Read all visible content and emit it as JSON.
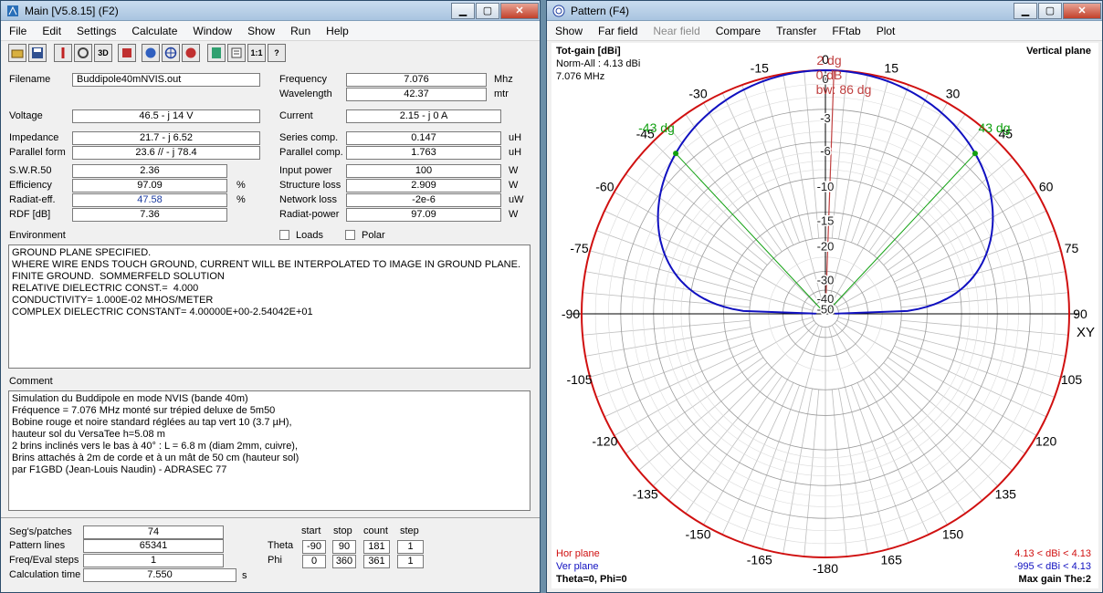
{
  "main": {
    "title": "Main [V5.8.15]   (F2)",
    "menu": [
      "File",
      "Edit",
      "Settings",
      "Calculate",
      "Window",
      "Show",
      "Run",
      "Help"
    ],
    "toolbar_icons": [
      "open-icon",
      "save-icon",
      "edit-icon",
      "3d-icon",
      "view-icon",
      "globe-icon",
      "pattern-icon",
      "sweep-icon",
      "calc-icon",
      "list-icon",
      "ratio-icon",
      "help-icon"
    ],
    "toolbar_text": {
      "3d": "3D",
      "ratio": "1:1",
      "help": "?"
    },
    "filename_label": "Filename",
    "filename": "Buddipole40mNVIS.out",
    "frequency_label": "Frequency",
    "frequency": "7.076",
    "frequency_unit": "Mhz",
    "wavelength_label": "Wavelength",
    "wavelength": "42.37",
    "wavelength_unit": "mtr",
    "voltage_label": "Voltage",
    "voltage": "46.5 - j 14 V",
    "current_label": "Current",
    "current": "2.15 - j 0 A",
    "impedance_label": "Impedance",
    "impedance": "21.7 - j 6.52",
    "parallel_label": "Parallel form",
    "parallel": "23.6 // - j 78.4",
    "series_comp_label": "Series comp.",
    "series_comp": "0.147",
    "series_comp_unit": "uH",
    "parallel_comp_label": "Parallel comp.",
    "parallel_comp": "1.763",
    "parallel_comp_unit": "uH",
    "swr_label": "S.W.R.50",
    "swr": "2.36",
    "efficiency_label": "Efficiency",
    "efficiency": "97.09",
    "pct": "%",
    "radiat_eff_label": "Radiat-eff.",
    "radiat_eff": "47.58",
    "rdf_label": "RDF [dB]",
    "rdf": "7.36",
    "input_power_label": "Input power",
    "input_power": "100",
    "structure_loss_label": "Structure loss",
    "structure_loss": "2.909",
    "network_loss_label": "Network loss",
    "network_loss": "-2e-6",
    "radiat_power_label": "Radiat-power",
    "radiat_power": "97.09",
    "w_unit": "W",
    "uw_unit": "uW",
    "environment_label": "Environment",
    "loads_label": "Loads",
    "polar_label": "Polar",
    "environment_text": "GROUND PLANE SPECIFIED.\nWHERE WIRE ENDS TOUCH GROUND, CURRENT WILL BE INTERPOLATED TO IMAGE IN GROUND PLANE.\nFINITE GROUND.  SOMMERFELD SOLUTION\nRELATIVE DIELECTRIC CONST.=  4.000\nCONDUCTIVITY= 1.000E-02 MHOS/METER\nCOMPLEX DIELECTRIC CONSTANT= 4.00000E+00-2.54042E+01",
    "comment_label": "Comment",
    "comment_text": "Simulation du Buddipole en mode NVIS (bande 40m)\nFréquence = 7.076 MHz monté sur trépied deluxe de 5m50\nBobine rouge et noire standard réglées au tap vert 10 (3.7 µH),\nhauteur sol du VersaTee h=5.08 m\n2 brins inclinés vers le bas à 40° : L = 6.8 m (diam 2mm, cuivre),\nBrins attachés à 2m de corde et à un mât de 50 cm (hauteur sol)\npar F1GBD (Jean-Louis Naudin) - ADRASEC 77",
    "segs_label": "Seg's/patches",
    "segs": "74",
    "pattern_lines_label": "Pattern lines",
    "pattern_lines": "65341",
    "freq_eval_label": "Freq/Eval steps",
    "freq_eval": "1",
    "calc_time_label": "Calculation time",
    "calc_time": "7.550",
    "calc_time_unit": "s",
    "col_start": "start",
    "col_stop": "stop",
    "col_count": "count",
    "col_step": "step",
    "theta_label": "Theta",
    "theta": [
      "-90",
      "90",
      "181",
      "1"
    ],
    "phi_label": "Phi",
    "phi": [
      "0",
      "360",
      "361",
      "1"
    ]
  },
  "pattern": {
    "title": "Pattern   (F4)",
    "menu": [
      "Show",
      "Far field",
      "Near field",
      "Compare",
      "Transfer",
      "FFtab",
      "Plot"
    ],
    "menu_disabled": [
      false,
      false,
      true,
      false,
      false,
      false,
      false
    ],
    "tot_gain": "Tot-gain [dBi]",
    "norm_all": "Norm-All : 4.13 dBi",
    "freq": "7.076 MHz",
    "plane": "Vertical plane",
    "gain_label": "2 dg",
    "db0": "0 dB",
    "bw": "bw: 86 dg",
    "left_beam": "-43 dg",
    "right_beam": "43 dg",
    "xy": "XY",
    "hor_plane": "Hor plane",
    "ver_plane": "Ver plane",
    "theta_phi": "Theta=0, Phi=0",
    "hor_range": "4.13 < dBi < 4.13",
    "ver_range": "-995 < dBi < 4.13",
    "max_gain": "Max gain The:2",
    "angle_labels": [
      "0",
      "15",
      "30",
      "45",
      "60",
      "75",
      "90",
      "105",
      "120",
      "135",
      "150",
      "165",
      "-180",
      "-165",
      "-150",
      "-135",
      "-120",
      "-105",
      "-90",
      "-75",
      "-60",
      "-45",
      "-30",
      "-15"
    ],
    "ring_labels": [
      "0",
      "-3",
      "-6",
      "-10",
      "-15",
      "-20",
      "-30",
      "-40",
      "-50"
    ],
    "colors": {
      "hor": "#d01010",
      "ver": "#1010c0",
      "beam": "#10a010",
      "bw": "#c04040"
    }
  }
}
